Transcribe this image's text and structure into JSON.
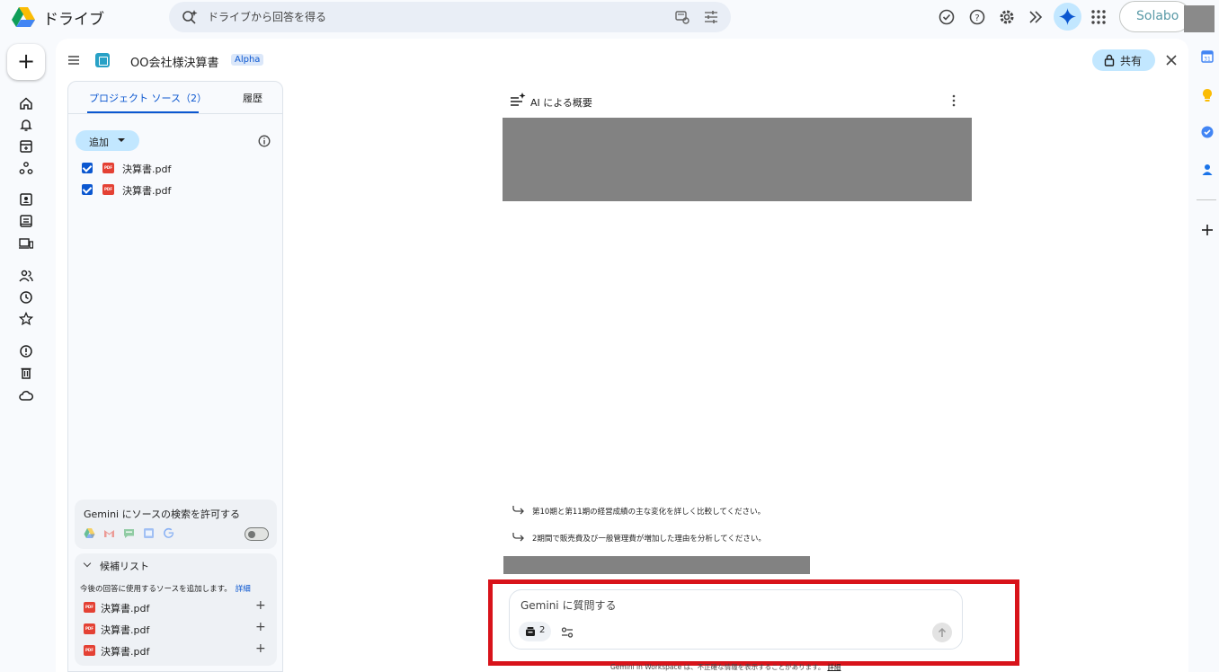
{
  "topbar": {
    "app_name": "ドライブ",
    "search_placeholder": "ドライブから回答を得る",
    "account_brand": "Solabo"
  },
  "document": {
    "title": "OO会社様決算書",
    "badge": "Alpha",
    "share_label": "共有"
  },
  "panel": {
    "tabs": [
      {
        "label": "プロジェクト ソース（2）",
        "active": true
      },
      {
        "label": "履歴",
        "active": false
      }
    ],
    "add_label": "追加",
    "sources": [
      {
        "name": "決算書.pdf",
        "checked": true,
        "icon": "PDF"
      },
      {
        "name": "決算書.pdf",
        "checked": true,
        "icon": "PDF"
      }
    ],
    "gemini_search_label": "Gemini にソースの検索を許可する",
    "gemini_search_enabled": false,
    "candidate_title": "候補リスト",
    "candidate_desc": "今後の回答に使用するソースを追加します。",
    "candidate_link": "詳細",
    "candidates": [
      {
        "name": "決算書.pdf",
        "icon": "PDF"
      },
      {
        "name": "決算書.pdf",
        "icon": "PDF"
      },
      {
        "name": "決算書.pdf",
        "icon": "PDF"
      }
    ]
  },
  "main": {
    "overview_title": "AI による概要",
    "suggestions": [
      "第10期と第11期の経営成績の主な変化を詳しく比較してください。",
      "2期間で販売費及び一般管理費が増加した理由を分析してください。"
    ],
    "ask_placeholder": "Gemini に質問する",
    "source_count": "2",
    "disclaimer": "Gemini in Workspace は、不正確な情報を表示することがあります。",
    "disclaimer_link": "詳細"
  },
  "colors": {
    "accent": "#0b57d0",
    "chip": "#c2e7ff",
    "highlight": "#d8131a",
    "redaction": "#828282"
  }
}
